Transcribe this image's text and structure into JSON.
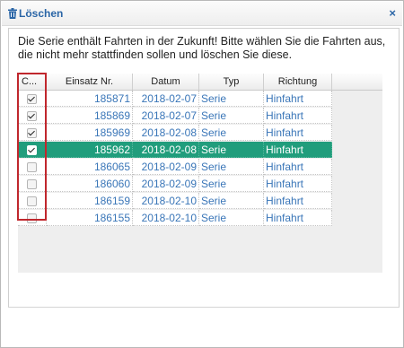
{
  "dialog": {
    "title": "Löschen",
    "close_symbol": "×",
    "message": "Die Serie enthält Fahrten in der Zukunft! Bitte wählen Sie die Fahrten aus, die nicht mehr stattfinden sollen und löschen Sie diese."
  },
  "grid": {
    "columns": [
      "C...",
      "Einsatz Nr.",
      "Datum",
      "Typ",
      "Richtung"
    ],
    "rows": [
      {
        "checked": true,
        "nr": "185871",
        "datum": "2018-02-07",
        "typ": "Serie",
        "richtung": "Hinfahrt",
        "selected": false
      },
      {
        "checked": true,
        "nr": "185869",
        "datum": "2018-02-07",
        "typ": "Serie",
        "richtung": "Hinfahrt",
        "selected": false
      },
      {
        "checked": true,
        "nr": "185969",
        "datum": "2018-02-08",
        "typ": "Serie",
        "richtung": "Hinfahrt",
        "selected": false
      },
      {
        "checked": true,
        "nr": "185962",
        "datum": "2018-02-08",
        "typ": "Serie",
        "richtung": "Hinfahrt",
        "selected": true
      },
      {
        "checked": false,
        "nr": "186065",
        "datum": "2018-02-09",
        "typ": "Serie",
        "richtung": "Hinfahrt",
        "selected": false
      },
      {
        "checked": false,
        "nr": "186060",
        "datum": "2018-02-09",
        "typ": "Serie",
        "richtung": "Hinfahrt",
        "selected": false
      },
      {
        "checked": false,
        "nr": "186159",
        "datum": "2018-02-10",
        "typ": "Serie",
        "richtung": "Hinfahrt",
        "selected": false
      },
      {
        "checked": false,
        "nr": "186155",
        "datum": "2018-02-10",
        "typ": "Serie",
        "richtung": "Hinfahrt",
        "selected": false
      }
    ]
  },
  "colors": {
    "accent": "#2a65a6",
    "selected_row": "#219d7c",
    "highlight_box": "#c0272d"
  },
  "icons": {
    "title": "trash-icon",
    "close": "close-icon"
  }
}
